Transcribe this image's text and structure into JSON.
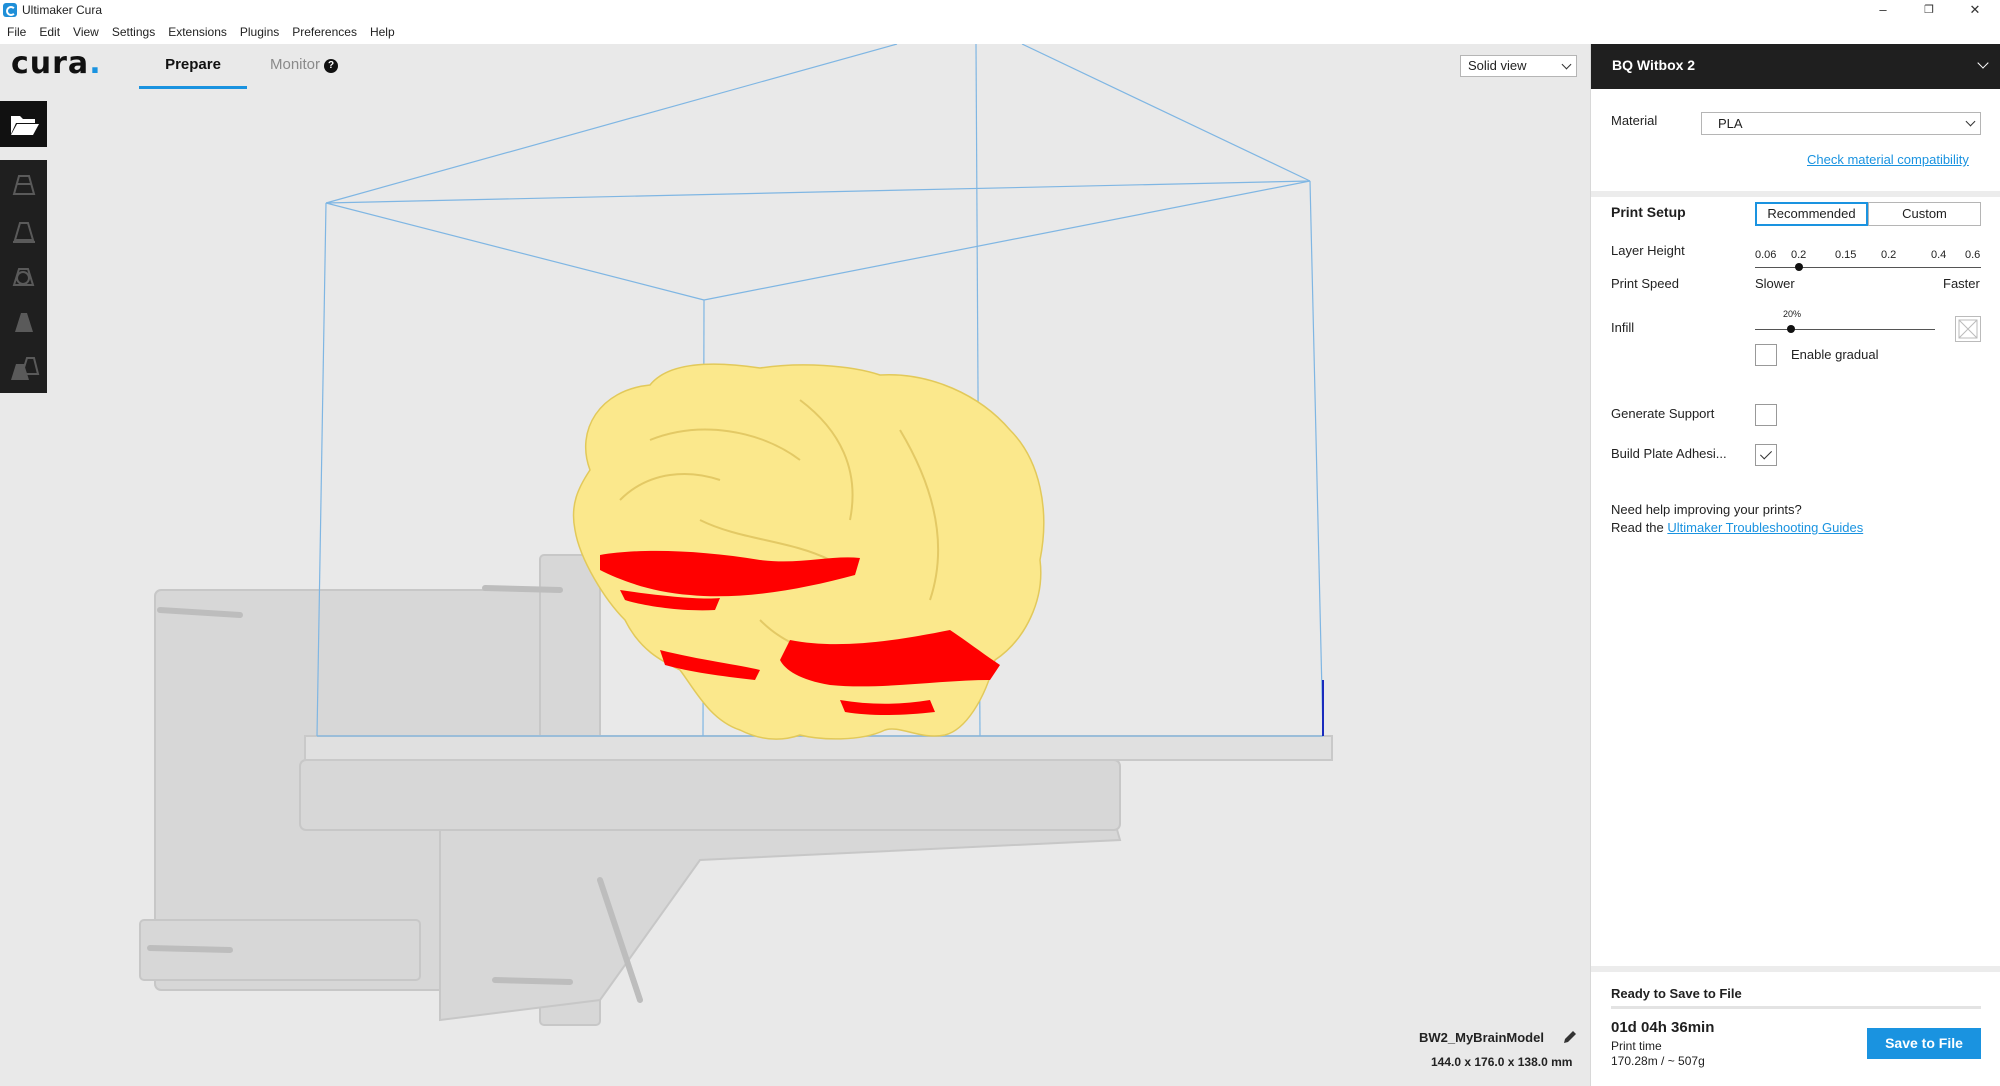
{
  "window": {
    "title": "Ultimaker Cura",
    "minimize": "–",
    "restore": "❐",
    "close": "✕"
  },
  "menu": [
    "File",
    "Edit",
    "View",
    "Settings",
    "Extensions",
    "Plugins",
    "Preferences",
    "Help"
  ],
  "header": {
    "logo": "cura",
    "logo_dot": ".",
    "tabs": {
      "prepare": "Prepare",
      "monitor": "Monitor"
    },
    "monitor_help": "?",
    "view_mode": "Solid view"
  },
  "toolbar": {
    "icons": [
      "open-folder-icon",
      "move-icon",
      "scale-icon",
      "rotate-icon",
      "mirror-icon",
      "per-model-settings-icon"
    ]
  },
  "model": {
    "name": "BW2_MyBrainModel",
    "dimensions": "144.0 x 176.0 x 138.0 mm"
  },
  "colors": {
    "accent": "#1a93e0",
    "model": "#fbe88c",
    "overhang": "#ff0000",
    "viewport": "#e9e9e9",
    "panel_header": "#1f1f1f"
  },
  "sidebar": {
    "machine": "BQ Witbox 2",
    "material_label": "Material",
    "material_value": "PLA",
    "check_compat": "Check material compatibility",
    "print_setup": "Print Setup",
    "mode_recommended": "Recommended",
    "mode_custom": "Custom",
    "layer_height_label": "Layer Height",
    "layer_height_ticks": [
      "0.06",
      "0.2",
      "0.15",
      "0.2",
      "0.4",
      "0.6"
    ],
    "layer_height_selected": "0.2",
    "print_speed_label": "Print Speed",
    "speed_slower": "Slower",
    "speed_faster": "Faster",
    "infill_label": "Infill",
    "infill_value": "20%",
    "enable_gradual": "Enable gradual",
    "enable_gradual_checked": false,
    "generate_support_label": "Generate Support",
    "generate_support_checked": false,
    "adhesion_label": "Build Plate Adhesi...",
    "adhesion_checked": true,
    "help_line1": "Need help improving your prints?",
    "help_read": "Read the ",
    "help_link": "Ultimaker Troubleshooting Guides"
  },
  "output": {
    "status": "Ready to Save to File",
    "print_time": "01d 04h 36min",
    "print_time_label": "Print time",
    "usage": "170.28m / ~ 507g",
    "save_button": "Save to File"
  }
}
